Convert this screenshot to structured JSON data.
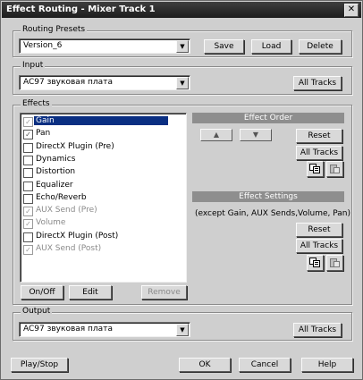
{
  "window": {
    "title": "Effect Routing - Mixer Track 1"
  },
  "routing_presets": {
    "label": "Routing Presets",
    "value": "Version_6",
    "save": "Save",
    "load": "Load",
    "delete": "Delete"
  },
  "input": {
    "label": "Input",
    "value": "AC97 звуковая плата",
    "all_tracks": "All Tracks"
  },
  "effects": {
    "label": "Effects",
    "items": [
      {
        "label": "Gain",
        "checked": true,
        "greyed": true,
        "selected": true
      },
      {
        "label": "Pan",
        "checked": true,
        "greyed": false,
        "selected": false
      },
      {
        "label": "DirectX Plugin (Pre)",
        "checked": false,
        "greyed": false,
        "selected": false
      },
      {
        "label": "Dynamics",
        "checked": false,
        "greyed": false,
        "selected": false
      },
      {
        "label": "Distortion",
        "checked": false,
        "greyed": false,
        "selected": false
      },
      {
        "label": "Equalizer",
        "checked": false,
        "greyed": false,
        "selected": false
      },
      {
        "label": "Echo/Reverb",
        "checked": false,
        "greyed": false,
        "selected": false
      },
      {
        "label": "AUX Send (Pre)",
        "checked": true,
        "greyed": true,
        "selected": false
      },
      {
        "label": "Volume",
        "checked": true,
        "greyed": true,
        "selected": false
      },
      {
        "label": "DirectX Plugin (Post)",
        "checked": false,
        "greyed": false,
        "selected": false
      },
      {
        "label": "AUX Send (Post)",
        "checked": true,
        "greyed": true,
        "selected": false
      }
    ],
    "on_off": "On/Off",
    "edit": "Edit",
    "remove": "Remove",
    "effect_order": {
      "header": "Effect Order",
      "up": "▲",
      "down": "▼",
      "reset": "Reset",
      "all_tracks": "All Tracks"
    },
    "effect_settings": {
      "header": "Effect Settings",
      "note": "(except Gain, AUX Sends,Volume, Pan)",
      "reset": "Reset",
      "all_tracks": "All Tracks"
    }
  },
  "output": {
    "label": "Output",
    "value": "AC97 звуковая плата",
    "all_tracks": "All Tracks"
  },
  "footer": {
    "play_stop": "Play/Stop",
    "ok": "OK",
    "cancel": "Cancel",
    "help": "Help"
  },
  "icons": {
    "copy": "copy-icon",
    "paste": "paste-icon",
    "dropdown": "chevron-down-icon",
    "close": "close-icon"
  }
}
